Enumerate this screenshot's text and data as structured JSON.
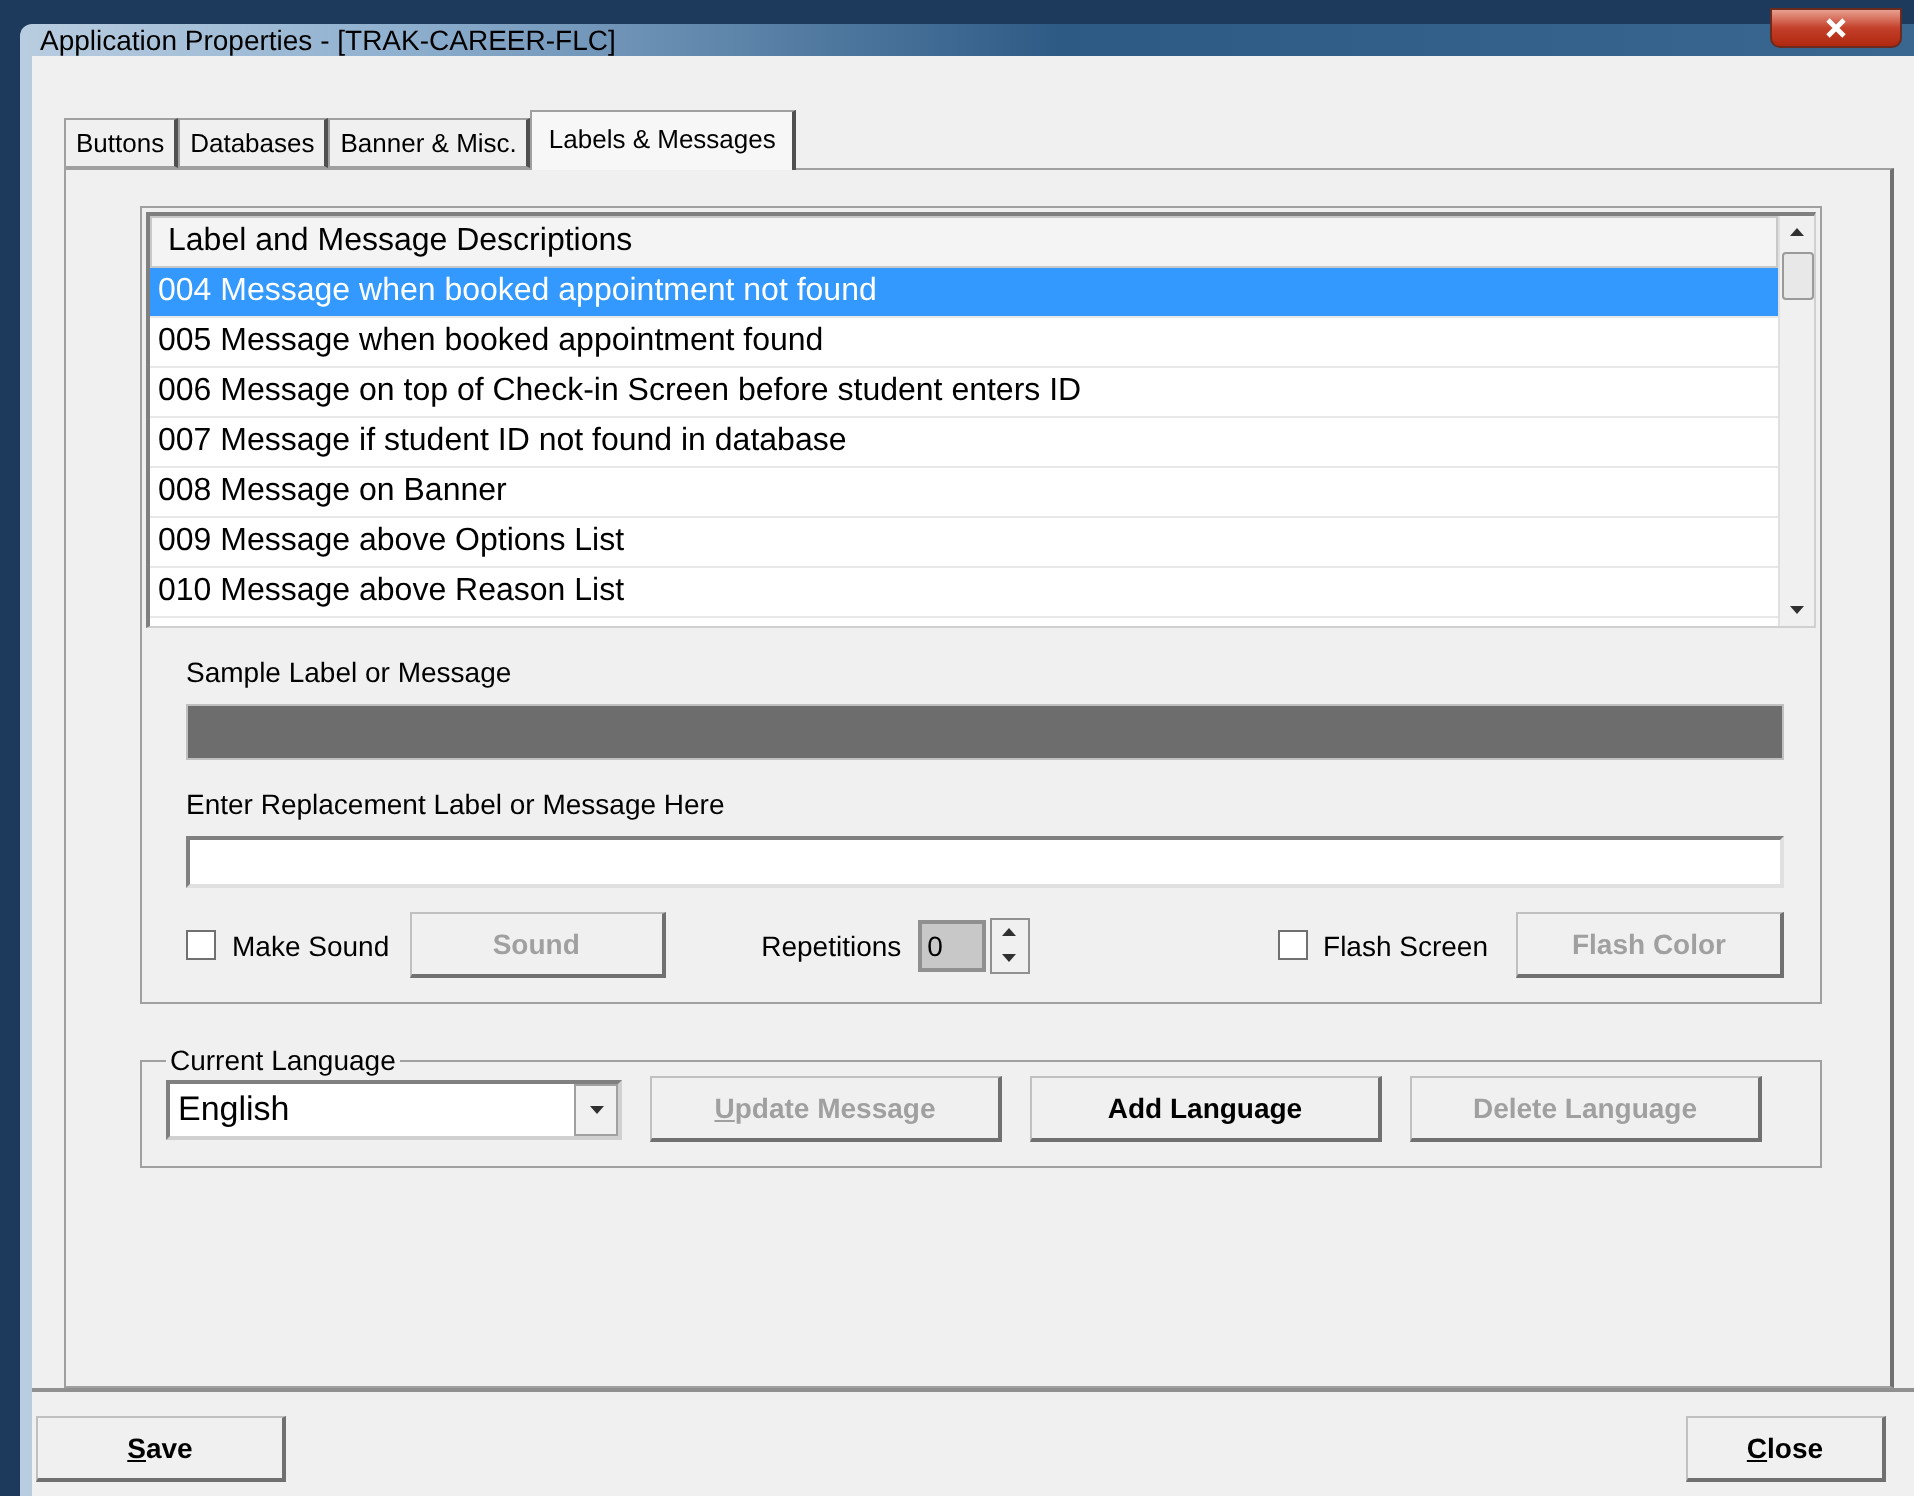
{
  "window": {
    "title": "Application Properties - [TRAK-CAREER-FLC]"
  },
  "tabs": [
    {
      "label": "Buttons",
      "selected": false
    },
    {
      "label": "Databases",
      "selected": false
    },
    {
      "label": "Banner & Misc.",
      "selected": false
    },
    {
      "label": "Labels & Messages",
      "selected": true
    }
  ],
  "list": {
    "header": "Label and Message Descriptions",
    "rows": [
      {
        "text": "004 Message when booked appointment not found",
        "selected": true
      },
      {
        "text": "005 Message when booked appointment found",
        "selected": false
      },
      {
        "text": "006 Message on top of Check-in Screen before student enters ID",
        "selected": false
      },
      {
        "text": "007 Message if student ID not found in database",
        "selected": false
      },
      {
        "text": "008 Message on Banner",
        "selected": false
      },
      {
        "text": "009 Message above Options List",
        "selected": false
      },
      {
        "text": "010 Message above Reason List",
        "selected": false
      }
    ]
  },
  "sample": {
    "label": "Sample Label or Message"
  },
  "replacement": {
    "label": "Enter Replacement Label or Message Here"
  },
  "make_sound": {
    "label": "Make Sound",
    "checked": false
  },
  "sound_button": {
    "label": "Sound",
    "disabled": true
  },
  "repetitions": {
    "label": "Repetitions",
    "value": "0",
    "disabled": true
  },
  "flash_screen": {
    "label": "Flash Screen",
    "checked": false
  },
  "flash_color_button": {
    "label": "Flash Color",
    "disabled": true
  },
  "language": {
    "group_label": "Current Language",
    "value": "English"
  },
  "language_buttons": [
    {
      "label": "Update Message",
      "disabled": true,
      "underline_first": true
    },
    {
      "label": "Add Language",
      "disabled": false,
      "underline_first": false
    },
    {
      "label": "Delete Language",
      "disabled": true,
      "underline_first": false
    }
  ],
  "footer_buttons": [
    {
      "label": "Save",
      "underline_first": true
    },
    {
      "label": "Close",
      "underline_first": true
    }
  ]
}
